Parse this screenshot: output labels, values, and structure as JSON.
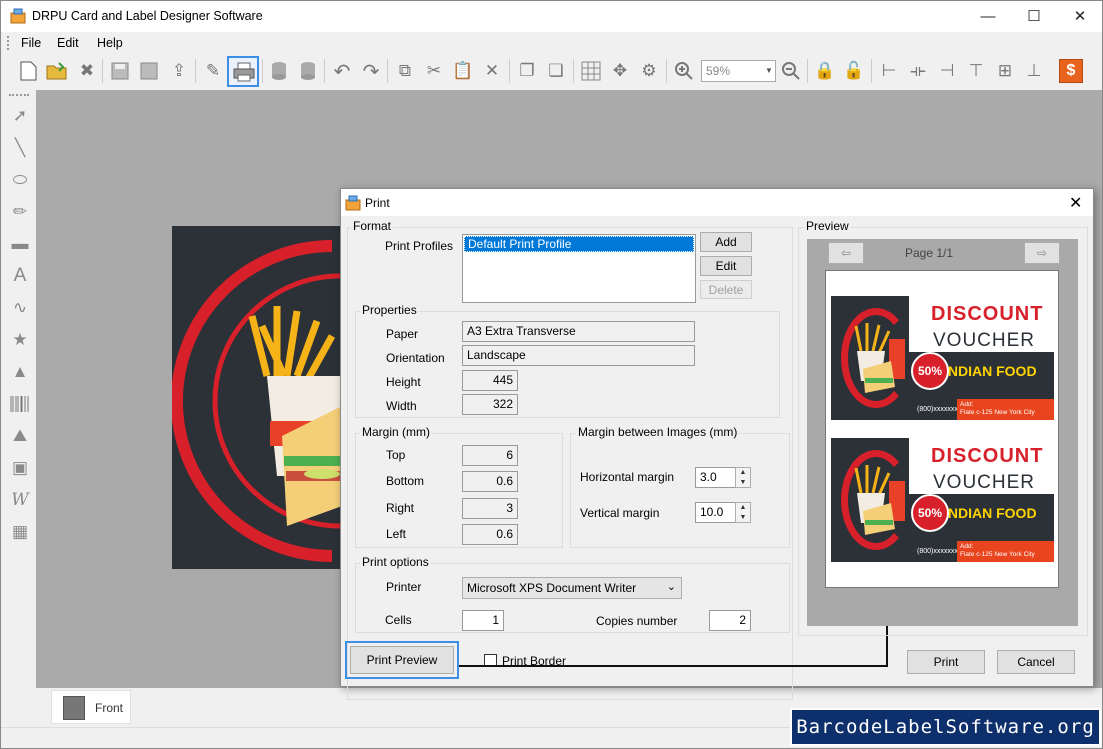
{
  "window": {
    "title": "DRPU Card and Label Designer Software",
    "minimize": "—",
    "maximize": "☐",
    "close": "✕"
  },
  "menu": [
    "File",
    "Edit",
    "Help"
  ],
  "toolbar": {
    "zoom_value": "59%"
  },
  "tabs": {
    "front": "Front"
  },
  "brand": "BarcodeLabelSoftware.org",
  "print_dialog": {
    "title": "Print",
    "close": "✕",
    "format": {
      "group_label": "Format",
      "profiles_label": "Print Profiles",
      "profiles": [
        "Default Print Profile"
      ],
      "add_button": "Add",
      "edit_button": "Edit",
      "delete_button": "Delete"
    },
    "properties": {
      "group_label": "Properties",
      "paper_label": "Paper",
      "paper_value": "A3 Extra Transverse",
      "orientation_label": "Orientation",
      "orientation_value": "Landscape",
      "height_label": "Height",
      "height_value": "445",
      "width_label": "Width",
      "width_value": "322"
    },
    "margin": {
      "group_label": "Margin (mm)",
      "top_label": "Top",
      "top_value": "6",
      "bottom_label": "Bottom",
      "bottom_value": "0.6",
      "right_label": "Right",
      "right_value": "3",
      "left_label": "Left",
      "left_value": "0.6"
    },
    "margin_between": {
      "group_label": "Margin between Images (mm)",
      "horizontal_label": "Horizontal margin",
      "horizontal_value": "3.0",
      "vertical_label": "Vertical margin",
      "vertical_value": "10.0"
    },
    "print_options": {
      "group_label": "Print options",
      "printer_label": "Printer",
      "printer_value": "Microsoft XPS Document Writer",
      "cells_label": "Cells",
      "cells_value": "1",
      "copies_label": "Copies number",
      "copies_value": "2"
    },
    "print_preview_button": "Print Preview",
    "print_border_label": "Print Border",
    "print_border_checked": false,
    "print_button": "Print",
    "cancel_button": "Cancel",
    "preview": {
      "group_label": "Preview",
      "page_label": "Page 1/1",
      "vouchers": [
        {
          "line1": "DISCOUNT",
          "line2": "VOUCHER",
          "percent": "50%",
          "food": "INDIAN FOOD",
          "phone": "(800)xxxxxxx",
          "address": "Add:\nFlate c-125 New York City"
        },
        {
          "line1": "DISCOUNT",
          "line2": "VOUCHER",
          "percent": "50%",
          "food": "INDIAN FOOD",
          "phone": "(800)xxxxxxx",
          "address": "Add:\nFlate c-125 New York City"
        }
      ]
    }
  },
  "colors": {
    "accent_red": "#d8202a",
    "dark": "#2b3137",
    "highlight_blue": "#3c8ee6",
    "brand_bg": "#0d2f6b"
  }
}
